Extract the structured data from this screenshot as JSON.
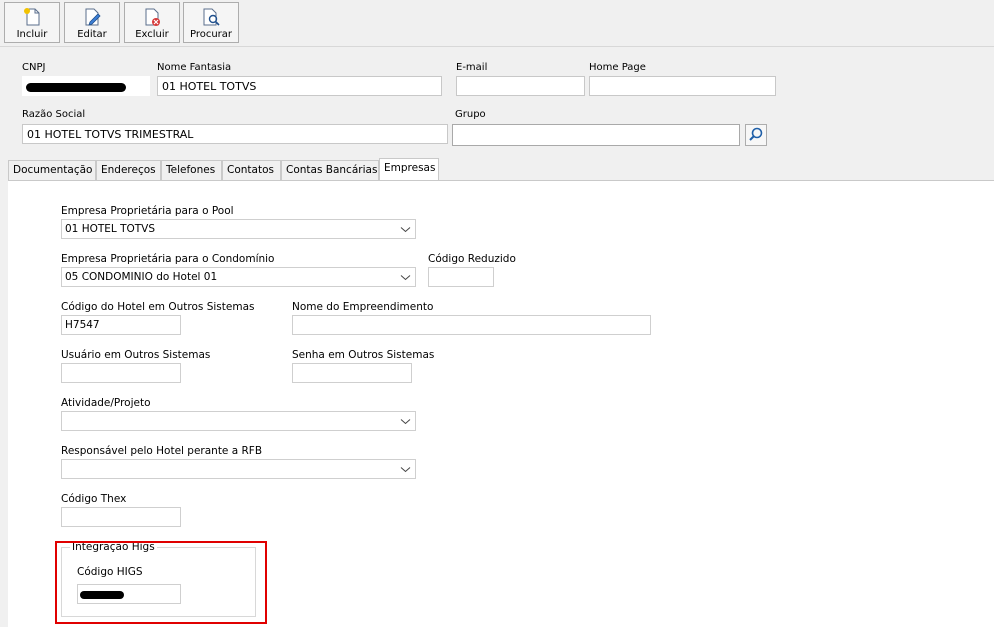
{
  "toolbar": {
    "buttons": [
      {
        "label": "Incluir",
        "icon": "new-document-icon"
      },
      {
        "label": "Editar",
        "icon": "edit-document-icon"
      },
      {
        "label": "Excluir",
        "icon": "delete-document-icon"
      },
      {
        "label": "Procurar",
        "icon": "search-document-icon"
      }
    ]
  },
  "header": {
    "cnpj": {
      "label": "CNPJ",
      "value": ""
    },
    "nome_fantasia": {
      "label": "Nome Fantasia",
      "value": "01 HOTEL TOTVS"
    },
    "email": {
      "label": "E-mail",
      "value": ""
    },
    "home_page": {
      "label": "Home Page",
      "value": ""
    },
    "razao_social": {
      "label": "Razão Social",
      "value": "01 HOTEL TOTVS TRIMESTRAL"
    },
    "grupo": {
      "label": "Grupo",
      "value": ""
    }
  },
  "tabs": [
    {
      "label": "Documentação",
      "active": false
    },
    {
      "label": "Endereços",
      "active": false
    },
    {
      "label": "Telefones",
      "active": false
    },
    {
      "label": "Contatos",
      "active": false
    },
    {
      "label": "Contas Bancárias",
      "active": false
    },
    {
      "label": "Empresas",
      "active": true
    }
  ],
  "empresas": {
    "pool": {
      "label": "Empresa Proprietária para o Pool",
      "value": "01 HOTEL TOTVS"
    },
    "condominio": {
      "label": "Empresa Proprietária para o Condomínio",
      "value": "05 CONDOMINIO do Hotel 01"
    },
    "codigo_reduzido": {
      "label": "Código Reduzido",
      "value": ""
    },
    "codigo_hotel": {
      "label": "Código do Hotel em Outros Sistemas",
      "value": "H7547"
    },
    "nome_empreendimento": {
      "label": "Nome do Empreendimento",
      "value": ""
    },
    "usuario": {
      "label": "Usuário em Outros Sistemas",
      "value": ""
    },
    "senha": {
      "label": "Senha em Outros Sistemas",
      "value": ""
    },
    "atividade": {
      "label": "Atividade/Projeto",
      "value": ""
    },
    "responsavel": {
      "label": "Responsável pelo Hotel perante a RFB",
      "value": ""
    },
    "codigo_thex": {
      "label": "Código Thex",
      "value": ""
    },
    "integracao": {
      "title": "Integração Higs",
      "codigo_higs_label": "Código HIGS",
      "codigo_higs_value": ""
    }
  },
  "colors": {
    "highlight": "#e00000",
    "field_border": "#cfcfcf"
  }
}
